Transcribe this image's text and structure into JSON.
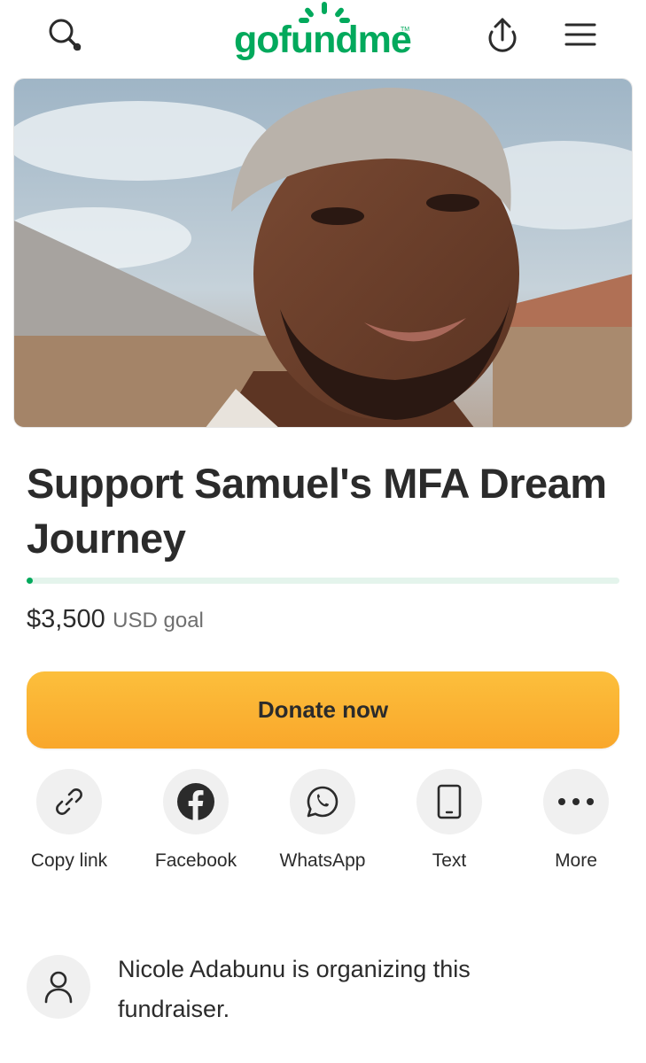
{
  "header": {
    "logo_text": "gofundme",
    "logo_tm": "TM",
    "brand_color": "#02a95c",
    "icons": [
      "search-icon",
      "share-upload-icon",
      "menu-icon"
    ]
  },
  "campaign": {
    "title": "Support Samuel's MFA Dream Journey",
    "progress_fraction": 0.005,
    "goal_amount": "$3,500",
    "goal_label": "USD goal"
  },
  "donate": {
    "label": "Donate now",
    "color": "#fbb034"
  },
  "share_options": [
    {
      "label": "Copy link",
      "icon": "link-icon"
    },
    {
      "label": "Facebook",
      "icon": "facebook-icon"
    },
    {
      "label": "WhatsApp",
      "icon": "whatsapp-icon"
    },
    {
      "label": "Text",
      "icon": "phone-icon"
    },
    {
      "label": "More",
      "icon": "more-dots-icon"
    }
  ],
  "organizer": {
    "text": "Nicole Adabunu is organizing this fundraiser."
  }
}
